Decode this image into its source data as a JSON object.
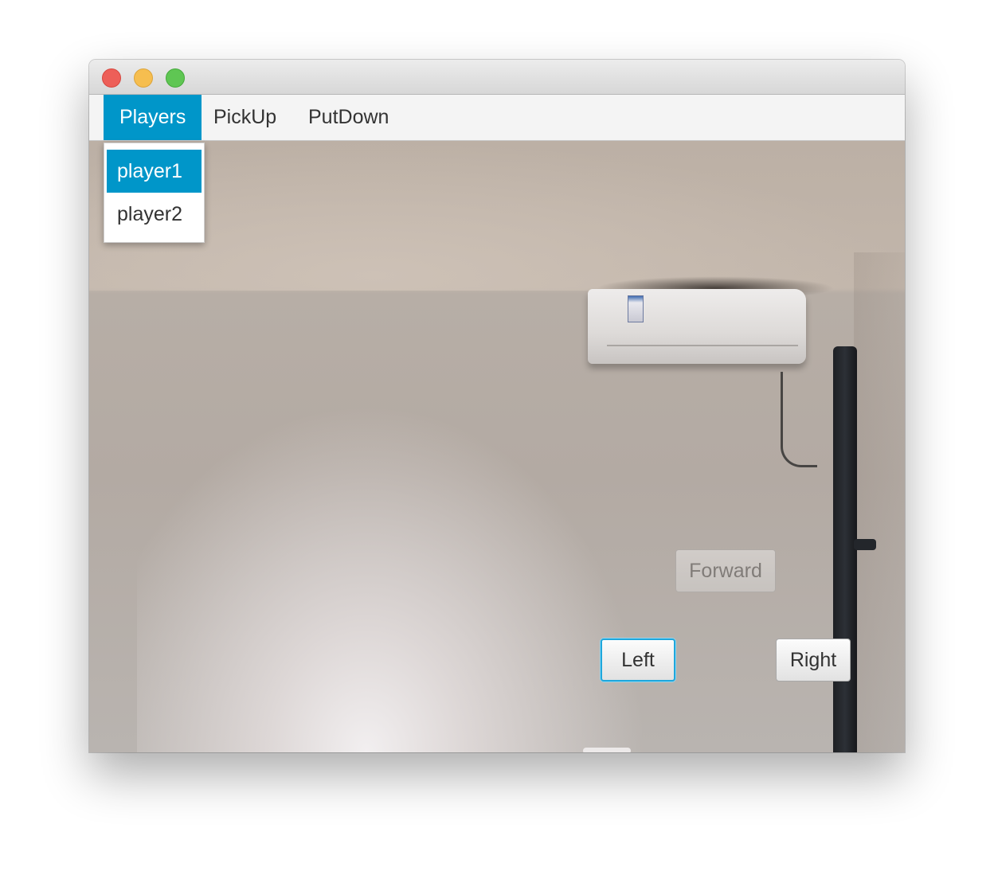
{
  "menubar": {
    "menus": [
      {
        "label": "Players",
        "active": true
      },
      {
        "label": "PickUp",
        "active": false
      },
      {
        "label": "PutDown",
        "active": false
      }
    ]
  },
  "players_menu": {
    "items": [
      {
        "label": "player1",
        "selected": true
      },
      {
        "label": "player2",
        "selected": false
      }
    ]
  },
  "controls": {
    "forward_label": "Forward",
    "forward_enabled": false,
    "left_label": "Left",
    "left_focused": true,
    "right_label": "Right"
  },
  "colors": {
    "accent": "#0096c9",
    "focus_ring": "#1fa7dc",
    "close": "#ed5f58",
    "minimize": "#f6be4f",
    "zoom": "#5fc653"
  },
  "icons": [
    "close-light",
    "minimize-light",
    "zoom-light"
  ]
}
